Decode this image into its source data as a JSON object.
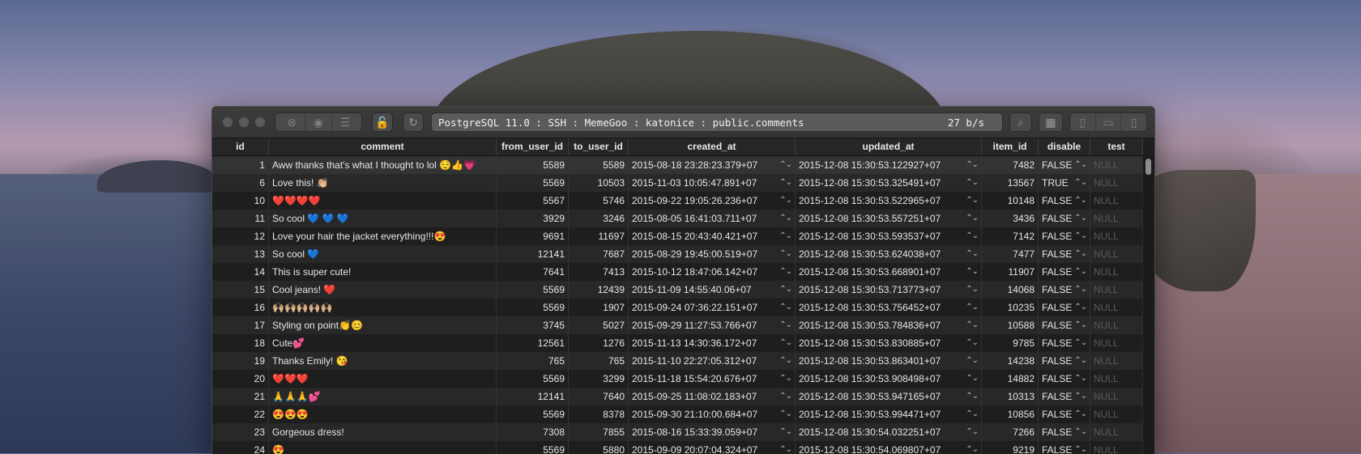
{
  "toolbar": {
    "connection": "PostgreSQL 11.0 : SSH : MemeGoo : katonice : public.comments",
    "speed": "27 b/s"
  },
  "columns": [
    "id",
    "comment",
    "from_user_id",
    "to_user_id",
    "created_at",
    "updated_at",
    "item_id",
    "disable",
    "test"
  ],
  "rows": [
    {
      "id": "1",
      "comment": "Aww thanks that's what I thought to lol 😌👍💗",
      "from": "5589",
      "to": "5589",
      "created": "2015-08-18 23:28:23.379+07",
      "updated": "2015-12-08 15:30:53.122927+07",
      "item": "7482",
      "disable": "FALSE",
      "test": "NULL"
    },
    {
      "id": "6",
      "comment": "Love this! 👏🏼",
      "from": "5569",
      "to": "10503",
      "created": "2015-11-03 10:05:47.891+07",
      "updated": "2015-12-08 15:30:53.325491+07",
      "item": "13567",
      "disable": "TRUE",
      "test": "NULL"
    },
    {
      "id": "10",
      "comment": "❤️❤️❤️❤️",
      "from": "5567",
      "to": "5746",
      "created": "2015-09-22 19:05:26.236+07",
      "updated": "2015-12-08 15:30:53.522965+07",
      "item": "10148",
      "disable": "FALSE",
      "test": "NULL"
    },
    {
      "id": "11",
      "comment": "So cool 💙 💙 💙",
      "from": "3929",
      "to": "3246",
      "created": "2015-08-05 16:41:03.711+07",
      "updated": "2015-12-08 15:30:53.557251+07",
      "item": "3436",
      "disable": "FALSE",
      "test": "NULL"
    },
    {
      "id": "12",
      "comment": "Love your hair the jacket everything!!!😍",
      "from": "9691",
      "to": "11697",
      "created": "2015-08-15 20:43:40.421+07",
      "updated": "2015-12-08 15:30:53.593537+07",
      "item": "7142",
      "disable": "FALSE",
      "test": "NULL"
    },
    {
      "id": "13",
      "comment": "So cool 💙",
      "from": "12141",
      "to": "7687",
      "created": "2015-08-29 19:45:00.519+07",
      "updated": "2015-12-08 15:30:53.624038+07",
      "item": "7477",
      "disable": "FALSE",
      "test": "NULL"
    },
    {
      "id": "14",
      "comment": "This is super cute!",
      "from": "7641",
      "to": "7413",
      "created": "2015-10-12 18:47:06.142+07",
      "updated": "2015-12-08 15:30:53.668901+07",
      "item": "11907",
      "disable": "FALSE",
      "test": "NULL"
    },
    {
      "id": "15",
      "comment": "Cool jeans! ❤️",
      "from": "5569",
      "to": "12439",
      "created": "2015-11-09 14:55:40.06+07",
      "updated": "2015-12-08 15:30:53.713773+07",
      "item": "14068",
      "disable": "FALSE",
      "test": "NULL"
    },
    {
      "id": "16",
      "comment": "🙌🏼🙌🏼🙌🏼🙌🏼🙌🏼",
      "from": "5569",
      "to": "1907",
      "created": "2015-09-24 07:36:22.151+07",
      "updated": "2015-12-08 15:30:53.756452+07",
      "item": "10235",
      "disable": "FALSE",
      "test": "NULL"
    },
    {
      "id": "17",
      "comment": "Styling on point👏😊",
      "from": "3745",
      "to": "5027",
      "created": "2015-09-29 11:27:53.766+07",
      "updated": "2015-12-08 15:30:53.784836+07",
      "item": "10588",
      "disable": "FALSE",
      "test": "NULL"
    },
    {
      "id": "18",
      "comment": "Cute💕",
      "from": "12561",
      "to": "1276",
      "created": "2015-11-13 14:30:36.172+07",
      "updated": "2015-12-08 15:30:53.830885+07",
      "item": "9785",
      "disable": "FALSE",
      "test": "NULL"
    },
    {
      "id": "19",
      "comment": "Thanks Emily! 😘",
      "from": "765",
      "to": "765",
      "created": "2015-11-10 22:27:05.312+07",
      "updated": "2015-12-08 15:30:53.863401+07",
      "item": "14238",
      "disable": "FALSE",
      "test": "NULL"
    },
    {
      "id": "20",
      "comment": "❤️❤️❤️",
      "from": "5569",
      "to": "3299",
      "created": "2015-11-18 15:54:20.676+07",
      "updated": "2015-12-08 15:30:53.908498+07",
      "item": "14882",
      "disable": "FALSE",
      "test": "NULL"
    },
    {
      "id": "21",
      "comment": "🙏🙏🙏💕",
      "from": "12141",
      "to": "7640",
      "created": "2015-09-25 11:08:02.183+07",
      "updated": "2015-12-08 15:30:53.947165+07",
      "item": "10313",
      "disable": "FALSE",
      "test": "NULL"
    },
    {
      "id": "22",
      "comment": "😍😍😍",
      "from": "5569",
      "to": "8378",
      "created": "2015-09-30 21:10:00.684+07",
      "updated": "2015-12-08 15:30:53.994471+07",
      "item": "10856",
      "disable": "FALSE",
      "test": "NULL"
    },
    {
      "id": "23",
      "comment": "Gorgeous dress!",
      "from": "7308",
      "to": "7855",
      "created": "2015-08-16 15:33:39.059+07",
      "updated": "2015-12-08 15:30:54.032251+07",
      "item": "7266",
      "disable": "FALSE",
      "test": "NULL"
    },
    {
      "id": "24",
      "comment": "😍",
      "from": "5569",
      "to": "5880",
      "created": "2015-09-09 20:07:04.324+07",
      "updated": "2015-12-08 15:30:54.069807+07",
      "item": "9219",
      "disable": "FALSE",
      "test": "NULL"
    }
  ]
}
